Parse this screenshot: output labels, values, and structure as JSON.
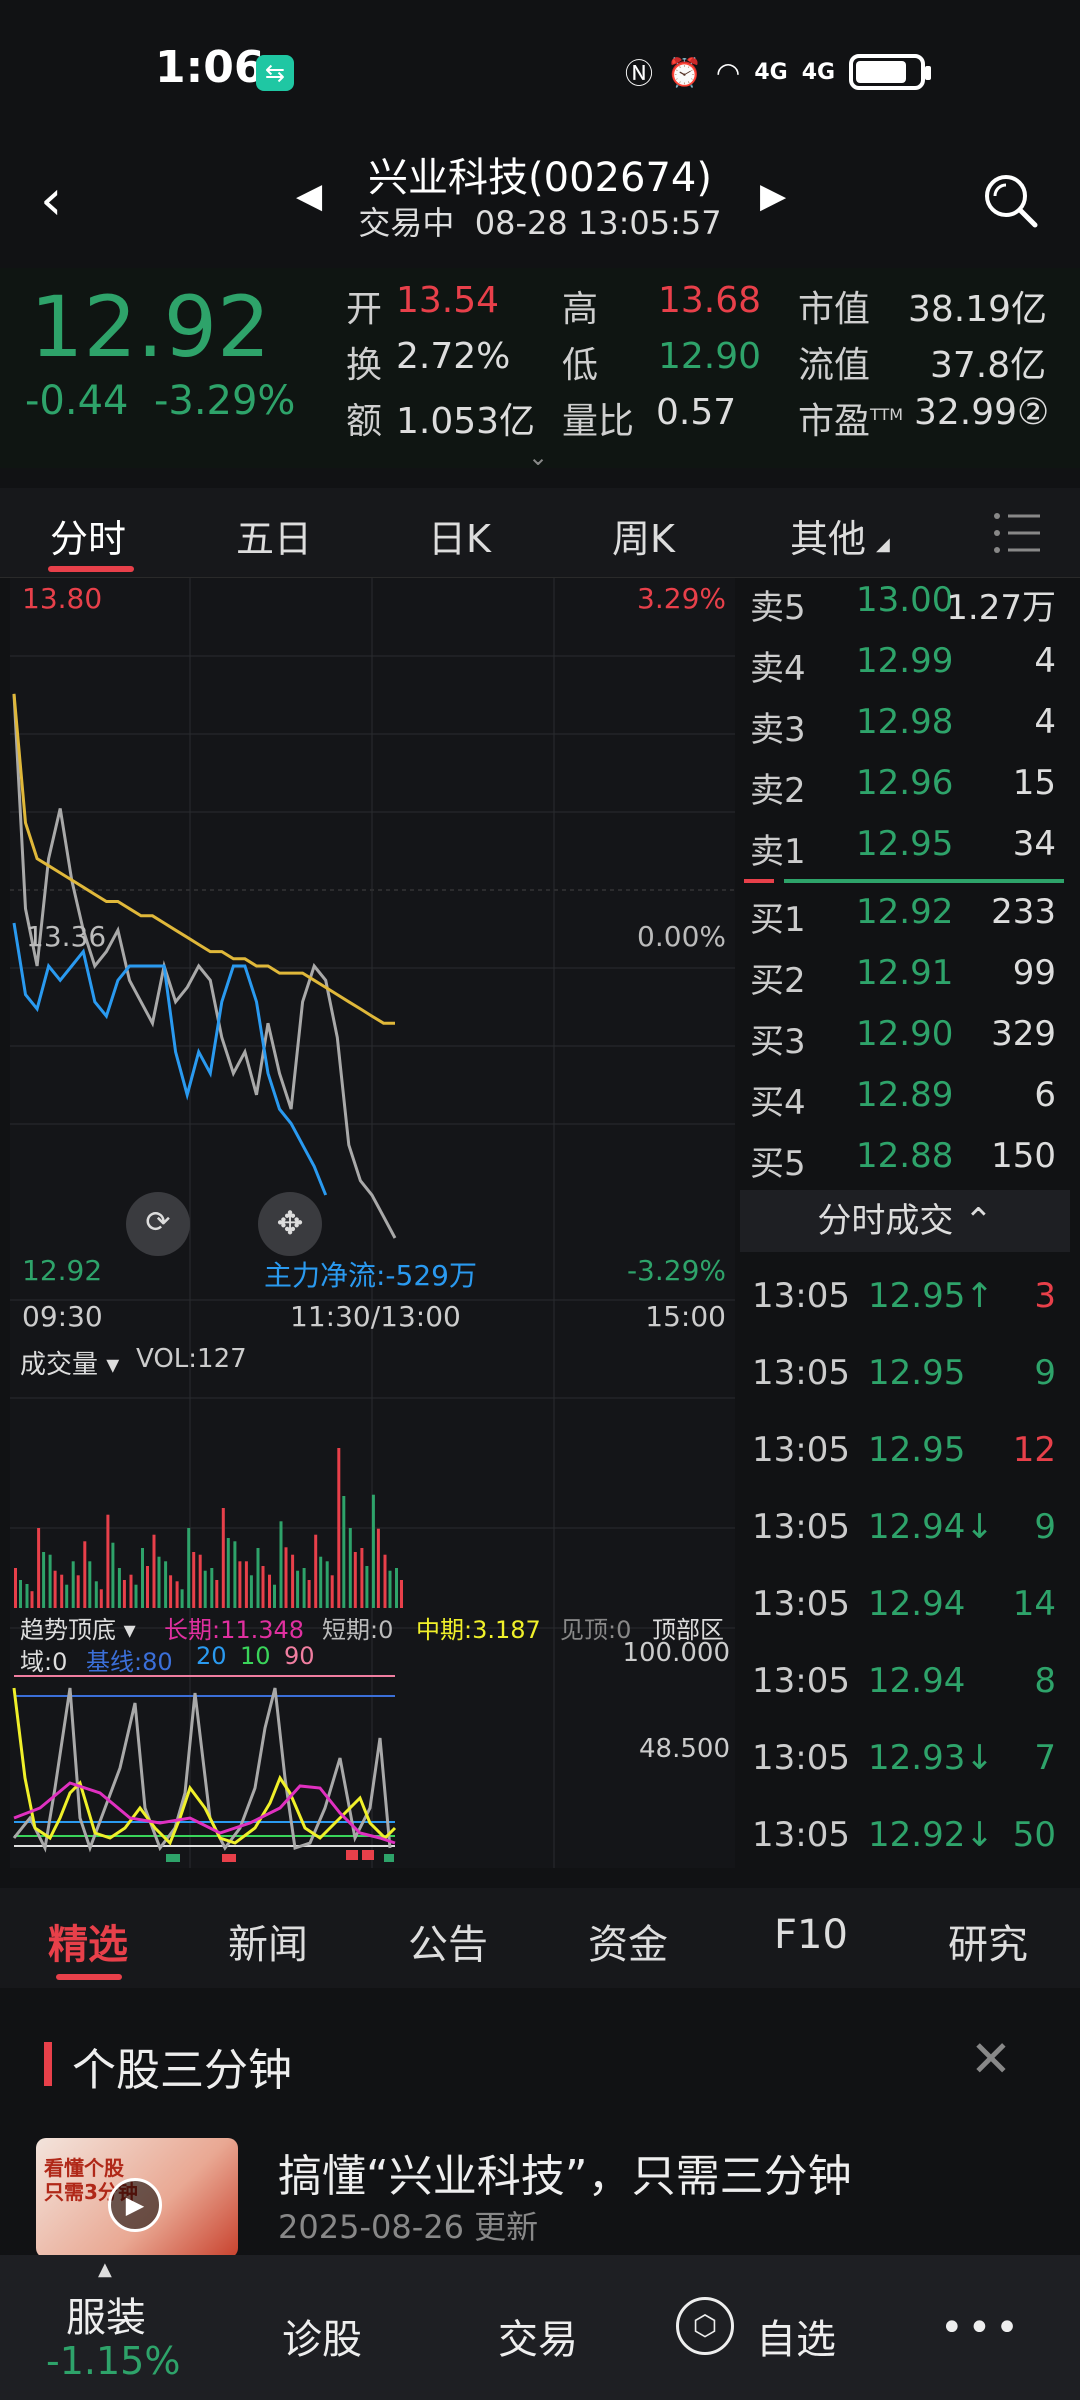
{
  "status": {
    "time": "1:06",
    "app_badge": "⇆",
    "icons": [
      "nfc-icon",
      "alarm-icon",
      "wifi-icon",
      "4g-signal-icon",
      "4g-signal-icon",
      "battery-charging-icon"
    ],
    "net1": "4G",
    "net2": "4G"
  },
  "header": {
    "back": "‹",
    "prev": "◀",
    "next": "▶",
    "title": "兴业科技(002674)",
    "status": "交易中",
    "datetime": "08-28 13:05:57"
  },
  "quote": {
    "price": "12.92",
    "change": "-0.44",
    "change_pct": "-3.29%",
    "open_label": "开",
    "open": "13.54",
    "high_label": "高",
    "high": "13.68",
    "mcap_label": "市值",
    "mcap": "38.19亿",
    "turn_label": "换",
    "turn": "2.72%",
    "low_label": "低",
    "low": "12.90",
    "float_label": "流值",
    "float": "37.8亿",
    "amt_label": "额",
    "amt": "1.053亿",
    "vr_label": "量比",
    "vr": "0.57",
    "pe_label": "市盈",
    "pe_sup": "TTM",
    "pe": "32.99②",
    "expand": "⌄"
  },
  "tabs": {
    "t1": "分时",
    "t2": "五日",
    "t3": "日K",
    "t4": "周K",
    "t5": "其他"
  },
  "chart_labels": {
    "top_price": "13.80",
    "top_pct": "3.29%",
    "mid_price": "13.36",
    "mid_pct": "0.00%",
    "bot_price": "12.92",
    "bot_pct": "-3.29%",
    "net_flow": "主力净流:-529万",
    "t_start": "09:30",
    "t_mid": "11:30/13:00",
    "t_end": "15:00",
    "vol_title": "成交量",
    "vol_value": "VOL:127",
    "ind_name": "趋势顶底",
    "ind_long": "长期:11.348",
    "ind_short": "短期:0",
    "ind_mid": "中期:3.187",
    "ind_top": "见顶:0",
    "ind_zone": "顶部区",
    "ind_domain": "域:0",
    "ind_base": "基线:80",
    "ind_20": "20",
    "ind_10": "10",
    "ind_90": "90",
    "ind_100": "100.000",
    "ind_48": "48.500"
  },
  "chart_data": {
    "type": "line",
    "ylim": [
      12.92,
      13.8
    ],
    "reference_price": 13.36,
    "series": [
      {
        "name": "",
        "color": "#a9a9a9",
        "values": [
          13.68,
          13.38,
          13.3,
          13.45,
          13.52,
          13.42,
          13.35,
          13.3,
          13.32,
          13.35,
          13.28,
          13.25,
          13.22,
          13.3,
          13.25,
          13.27,
          13.3,
          13.28,
          13.2,
          13.15,
          13.18,
          13.12,
          13.22,
          13.15,
          13.1,
          13.25,
          13.3,
          13.28,
          13.2,
          13.05,
          13.0,
          12.98,
          12.95,
          12.92
        ]
      },
      {
        "name": "",
        "color": "#e0b83a",
        "values": [
          13.68,
          13.5,
          13.45,
          13.44,
          13.43,
          13.42,
          13.41,
          13.4,
          13.39,
          13.39,
          13.38,
          13.37,
          13.37,
          13.36,
          13.35,
          13.34,
          13.33,
          13.32,
          13.32,
          13.31,
          13.31,
          13.3,
          13.3,
          13.29,
          13.29,
          13.29,
          13.28,
          13.27,
          13.26,
          13.25,
          13.24,
          13.23,
          13.22,
          13.22
        ]
      },
      {
        "name": "",
        "color": "#2a9af0",
        "values": [
          13.36,
          13.26,
          13.24,
          13.3,
          13.28,
          13.3,
          13.32,
          13.25,
          13.23,
          13.28,
          13.3,
          13.3,
          13.3,
          13.3,
          13.18,
          13.12,
          13.18,
          13.15,
          13.25,
          13.3,
          13.3,
          13.25,
          13.15,
          13.1,
          13.08,
          13.05,
          13.02,
          12.98
        ]
      }
    ],
    "volume": [
      30,
      18,
      60,
      40,
      25,
      35,
      50,
      20,
      70,
      30,
      25,
      45,
      55,
      35,
      20,
      60,
      40,
      30,
      75,
      50,
      35,
      45,
      25,
      65,
      40,
      30,
      55,
      35,
      120,
      60,
      45,
      85,
      40,
      30
    ]
  },
  "book": {
    "asks": [
      {
        "label": "卖5",
        "price": "13.00",
        "vol": "1.27万"
      },
      {
        "label": "卖4",
        "price": "12.99",
        "vol": "4"
      },
      {
        "label": "卖3",
        "price": "12.98",
        "vol": "4"
      },
      {
        "label": "卖2",
        "price": "12.96",
        "vol": "15"
      },
      {
        "label": "卖1",
        "price": "12.95",
        "vol": "34"
      }
    ],
    "bids": [
      {
        "label": "买1",
        "price": "12.92",
        "vol": "233"
      },
      {
        "label": "买2",
        "price": "12.91",
        "vol": "99"
      },
      {
        "label": "买3",
        "price": "12.90",
        "vol": "329"
      },
      {
        "label": "买4",
        "price": "12.89",
        "vol": "6"
      },
      {
        "label": "买5",
        "price": "12.88",
        "vol": "150"
      }
    ],
    "trades_title": "分时成交 ⌃",
    "trades": [
      {
        "time": "13:05",
        "price": "12.95↑",
        "vol": "3",
        "c": "red"
      },
      {
        "time": "13:05",
        "price": "12.95",
        "vol": "9",
        "c": "green"
      },
      {
        "time": "13:05",
        "price": "12.95",
        "vol": "12",
        "c": "red"
      },
      {
        "time": "13:05",
        "price": "12.94↓",
        "vol": "9",
        "c": "green"
      },
      {
        "time": "13:05",
        "price": "12.94",
        "vol": "14",
        "c": "green"
      },
      {
        "time": "13:05",
        "price": "12.94",
        "vol": "8",
        "c": "green"
      },
      {
        "time": "13:05",
        "price": "12.93↓",
        "vol": "7",
        "c": "green"
      },
      {
        "time": "13:05",
        "price": "12.92↓",
        "vol": "50",
        "c": "green"
      }
    ]
  },
  "news_tabs": {
    "n1": "精选",
    "n2": "新闻",
    "n3": "公告",
    "n4": "资金",
    "n5": "F10",
    "n6": "研究"
  },
  "news": {
    "section": "个股三分钟",
    "close": "✕",
    "thumb_text": "看懂个股\n只需3分钟",
    "play": "▶",
    "title": "搞懂“兴业科技”，只需三分钟",
    "date": "2025-08-26 更新"
  },
  "bottom": {
    "sector": "服装",
    "sector_chg": "-1.15%",
    "b2": "诊股",
    "b3": "交易",
    "b4": "自选",
    "more": "•••"
  }
}
